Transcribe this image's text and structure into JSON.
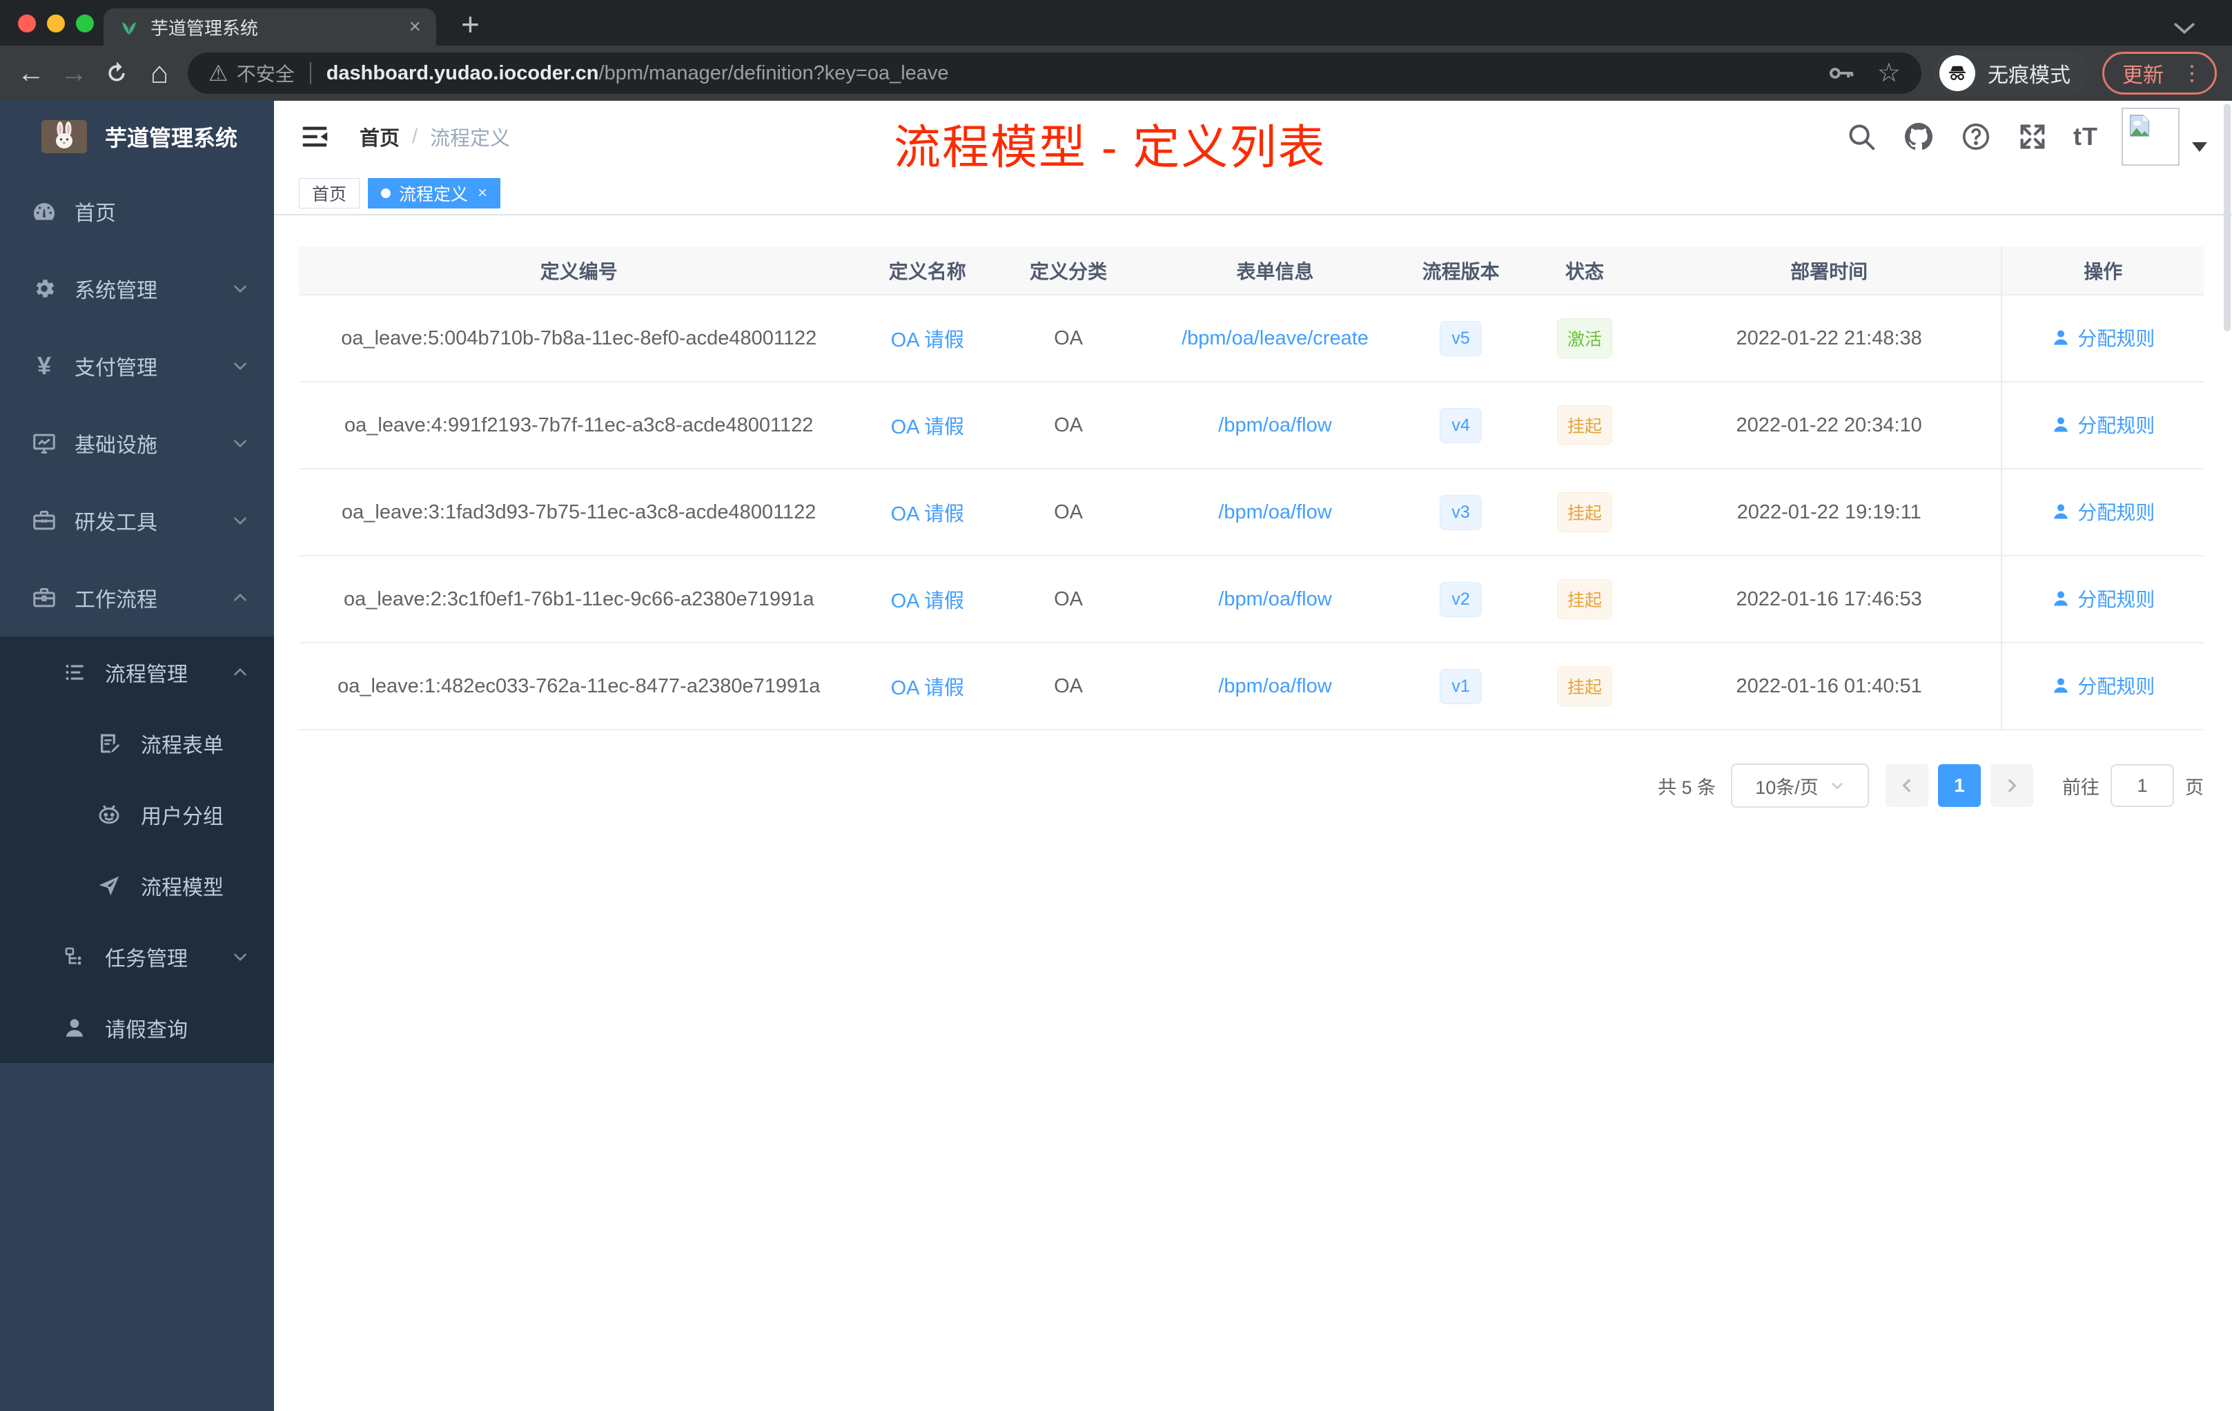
{
  "browser": {
    "tab_title": "芋道管理系统",
    "new_tab_label": "+",
    "close_tab_label": "×",
    "security_label": "不安全",
    "url_domain": "dashboard.yudao.iocoder.cn",
    "url_path": "/bpm/manager/definition?key=oa_leave",
    "incognito_label": "无痕模式",
    "update_label": "更新",
    "menu_dots": "⋮"
  },
  "sidebar": {
    "logo_title": "芋道管理系统",
    "items": [
      {
        "label": "首页",
        "icon": "dashboard",
        "level": 0,
        "chevron": null
      },
      {
        "label": "系统管理",
        "icon": "gear",
        "level": 0,
        "chevron": "down"
      },
      {
        "label": "支付管理",
        "icon": "yen",
        "level": 0,
        "chevron": "down"
      },
      {
        "label": "基础设施",
        "icon": "monitor",
        "level": 0,
        "chevron": "down"
      },
      {
        "label": "研发工具",
        "icon": "toolbox",
        "level": 0,
        "chevron": "down"
      },
      {
        "label": "工作流程",
        "icon": "briefcase",
        "level": 0,
        "chevron": "up"
      },
      {
        "label": "流程管理",
        "icon": "list",
        "level": 1,
        "chevron": "up"
      },
      {
        "label": "流程表单",
        "icon": "form",
        "level": 2,
        "chevron": null
      },
      {
        "label": "用户分组",
        "icon": "robot",
        "level": 2,
        "chevron": null
      },
      {
        "label": "流程模型",
        "icon": "send",
        "level": 2,
        "chevron": null
      },
      {
        "label": "任务管理",
        "icon": "tree",
        "level": 1,
        "chevron": "down"
      },
      {
        "label": "请假查询",
        "icon": "user",
        "level": 1,
        "chevron": null
      }
    ]
  },
  "header": {
    "breadcrumb_home": "首页",
    "breadcrumb_separator": "/",
    "breadcrumb_current": "流程定义",
    "annotation": "流程模型 - 定义列表",
    "font_size_icon_label": "tT"
  },
  "tags": {
    "home": "首页",
    "active": "流程定义",
    "active_close": "×"
  },
  "table": {
    "columns": [
      "定义编号",
      "定义名称",
      "定义分类",
      "表单信息",
      "流程版本",
      "状态",
      "部署时间",
      "操作"
    ],
    "rows": [
      {
        "id": "oa_leave:5:004b710b-7b8a-11ec-8ef0-acde48001122",
        "name": "OA 请假",
        "category": "OA",
        "form": "/bpm/oa/leave/create",
        "version": "v5",
        "status": "激活",
        "status_type": "success",
        "deployed_at": "2022-01-22 21:48:38",
        "action": "分配规则"
      },
      {
        "id": "oa_leave:4:991f2193-7b7f-11ec-a3c8-acde48001122",
        "name": "OA 请假",
        "category": "OA",
        "form": "/bpm/oa/flow",
        "version": "v4",
        "status": "挂起",
        "status_type": "warning",
        "deployed_at": "2022-01-22 20:34:10",
        "action": "分配规则"
      },
      {
        "id": "oa_leave:3:1fad3d93-7b75-11ec-a3c8-acde48001122",
        "name": "OA 请假",
        "category": "OA",
        "form": "/bpm/oa/flow",
        "version": "v3",
        "status": "挂起",
        "status_type": "warning",
        "deployed_at": "2022-01-22 19:19:11",
        "action": "分配规则"
      },
      {
        "id": "oa_leave:2:3c1f0ef1-76b1-11ec-9c66-a2380e71991a",
        "name": "OA 请假",
        "category": "OA",
        "form": "/bpm/oa/flow",
        "version": "v2",
        "status": "挂起",
        "status_type": "warning",
        "deployed_at": "2022-01-16 17:46:53",
        "action": "分配规则"
      },
      {
        "id": "oa_leave:1:482ec033-762a-11ec-8477-a2380e71991a",
        "name": "OA 请假",
        "category": "OA",
        "form": "/bpm/oa/flow",
        "version": "v1",
        "status": "挂起",
        "status_type": "warning",
        "deployed_at": "2022-01-16 01:40:51",
        "action": "分配规则"
      }
    ]
  },
  "pagination": {
    "total": "共 5 条",
    "page_size": "10条/页",
    "current_page": "1",
    "goto_label": "前往",
    "goto_value": "1",
    "page_unit": "页"
  },
  "colors": {
    "accent_blue": "#409eff",
    "annotation_red": "#fd2b01",
    "status_active_green": "#67c23a",
    "status_suspended_orange": "#e6a23c",
    "sidebar_bg": "#304156",
    "submenu_bg": "#1f2d3d",
    "incognito_update_red": "#f28b82"
  }
}
